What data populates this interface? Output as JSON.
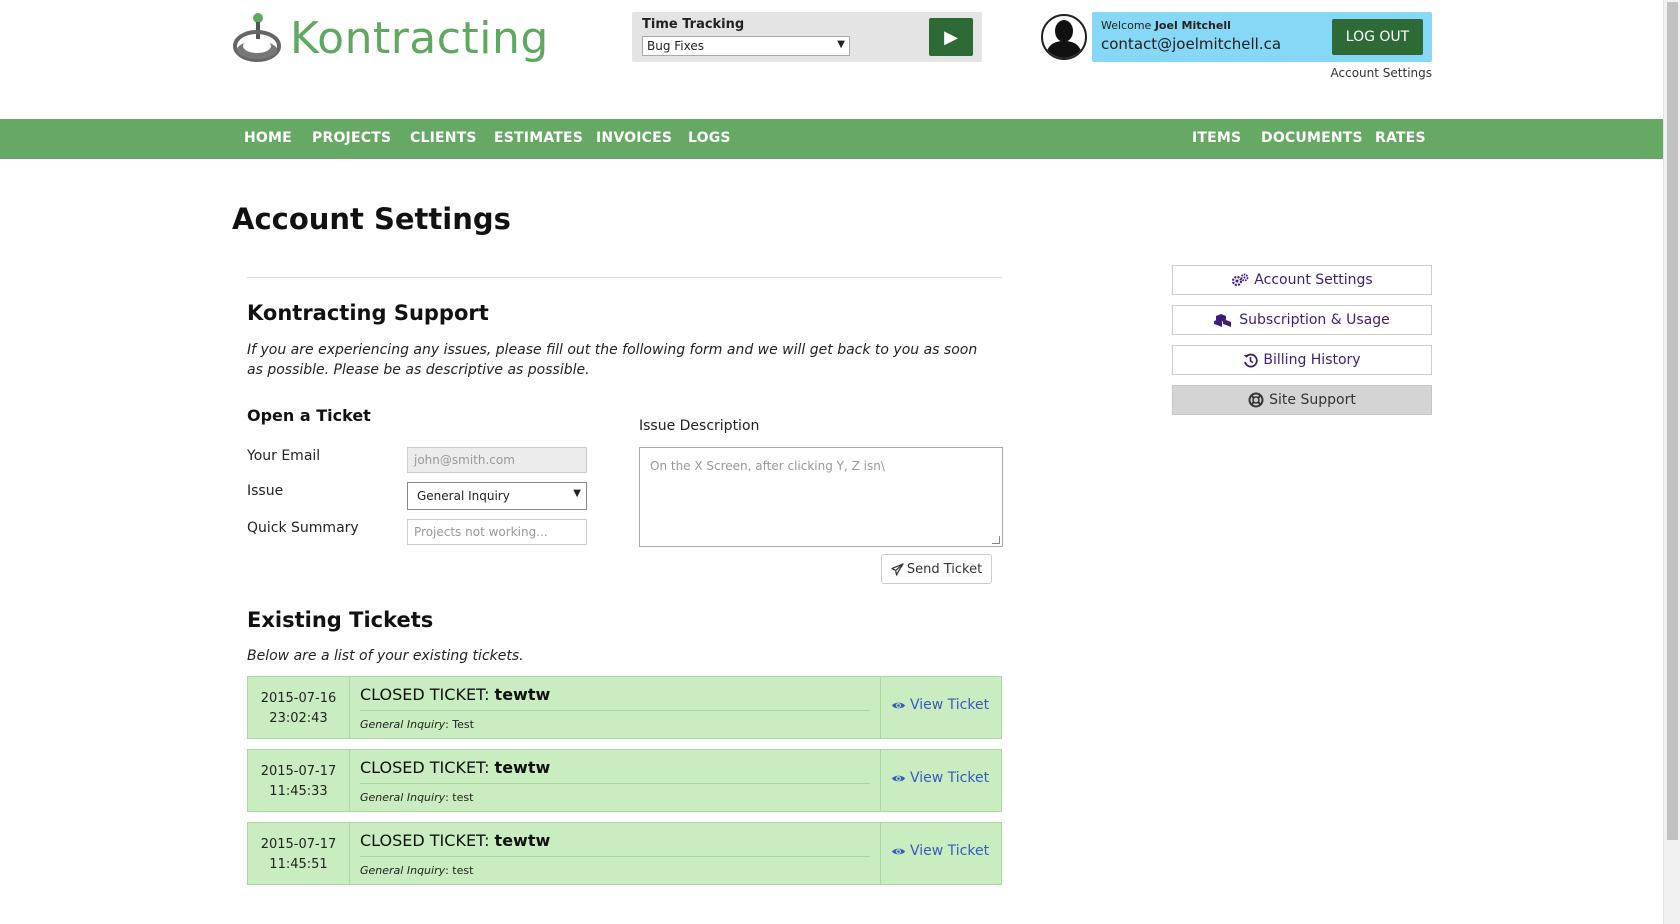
{
  "header": {
    "brand": "Kontracting",
    "time_tracking": {
      "label": "Time Tracking",
      "selected": "Bug Fixes"
    },
    "user": {
      "welcome_prefix": "Welcome ",
      "name": "Joel Mitchell",
      "email": "contact@joelmitchell.ca",
      "logout_label": "LOG OUT",
      "account_link": "Account Settings"
    }
  },
  "nav": {
    "left": [
      "HOME",
      "PROJECTS",
      "CLIENTS",
      "ESTIMATES",
      "INVOICES",
      "LOGS"
    ],
    "right": [
      "ITEMS",
      "DOCUMENTS",
      "RATES"
    ]
  },
  "page": {
    "title": "Account Settings",
    "support": {
      "heading": "Kontracting Support",
      "intro": "If you are experiencing any issues, please fill out the following form and we will get back to you as soon as possible. Please be as descriptive as possible."
    },
    "ticket_form": {
      "heading": "Open a Ticket",
      "email_label": "Your Email",
      "email_placeholder": "john@smith.com",
      "issue_label": "Issue",
      "issue_selected": "General Inquiry",
      "summary_label": "Quick Summary",
      "summary_placeholder": "Projects not working...",
      "description_label": "Issue Description",
      "description_placeholder": "On the X Screen, after clicking Y, Z isn\\",
      "send_label": "Send Ticket"
    },
    "existing": {
      "heading": "Existing Tickets",
      "intro": "Below are a list of your existing tickets.",
      "tickets": [
        {
          "date": "2015-07-16",
          "time": "23:02:43",
          "status": "CLOSED TICKET: ",
          "subject": "tewtw",
          "category": "General Inquiry",
          "detail": ": Test",
          "link": "View Ticket"
        },
        {
          "date": "2015-07-17",
          "time": "11:45:33",
          "status": "CLOSED TICKET: ",
          "subject": "tewtw",
          "category": "General Inquiry",
          "detail": ": test",
          "link": "View Ticket"
        },
        {
          "date": "2015-07-17",
          "time": "11:45:51",
          "status": "CLOSED TICKET: ",
          "subject": "tewtw",
          "category": "General Inquiry",
          "detail": ": test",
          "link": "View Ticket"
        }
      ]
    }
  },
  "sidebar": {
    "items": [
      {
        "label": "Account Settings",
        "icon": "gears-icon",
        "active": false
      },
      {
        "label": "Subscription & Usage",
        "icon": "cubes-icon",
        "active": false
      },
      {
        "label": "Billing History",
        "icon": "history-icon",
        "active": false
      },
      {
        "label": "Site Support",
        "icon": "life-ring-icon",
        "active": true
      }
    ]
  },
  "colors": {
    "brand_green": "#65a965",
    "dark_green": "#2d6a35",
    "welcome_blue": "#86d8f6",
    "ticket_green": "#c9edc0",
    "link_blue": "#3a5bb8",
    "sidebar_purple": "#3f1d7a"
  }
}
